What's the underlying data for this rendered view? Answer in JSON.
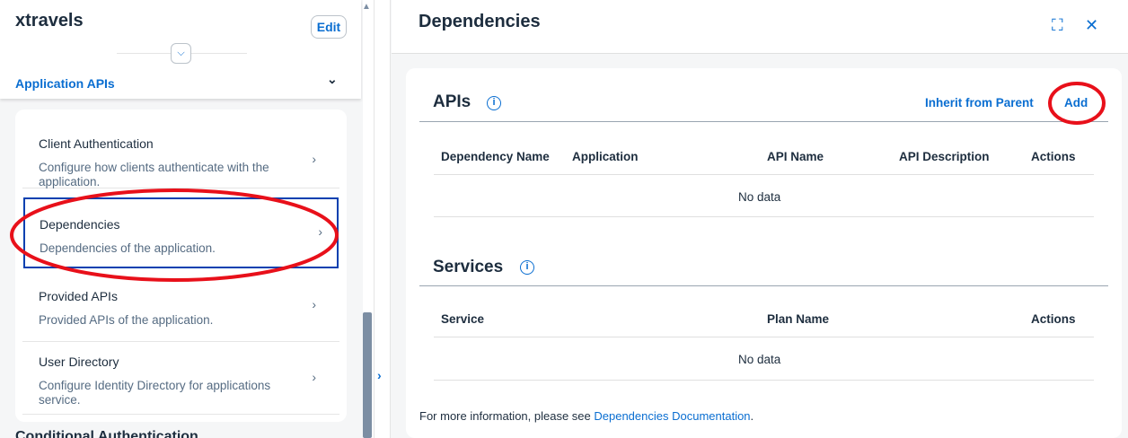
{
  "left": {
    "app_title": "xtravels",
    "edit_label": "Edit",
    "section": "Application APIs",
    "items": [
      {
        "title": "Client Authentication",
        "desc": "Configure how clients authenticate with the application."
      },
      {
        "title": "Dependencies",
        "desc": "Dependencies of the application."
      },
      {
        "title": "Provided APIs",
        "desc": "Provided APIs of the application."
      },
      {
        "title": "User Directory",
        "desc": "Configure Identity Directory for applications service."
      }
    ],
    "next_section": "Conditional Authentication"
  },
  "right": {
    "title": "Dependencies",
    "apis": {
      "heading": "APIs",
      "inherit_label": "Inherit from Parent",
      "add_label": "Add",
      "columns": [
        "Dependency Name",
        "Application",
        "API Name",
        "API Description",
        "Actions"
      ],
      "empty": "No data"
    },
    "services": {
      "heading": "Services",
      "columns": [
        "Service",
        "Plan Name",
        "Actions"
      ],
      "empty": "No data"
    },
    "footer_text": "For more information, please see ",
    "footer_link": "Dependencies Documentation",
    "footer_end": "."
  },
  "colors": {
    "accent": "#0a6ed1",
    "annotation": "#e8101a"
  }
}
